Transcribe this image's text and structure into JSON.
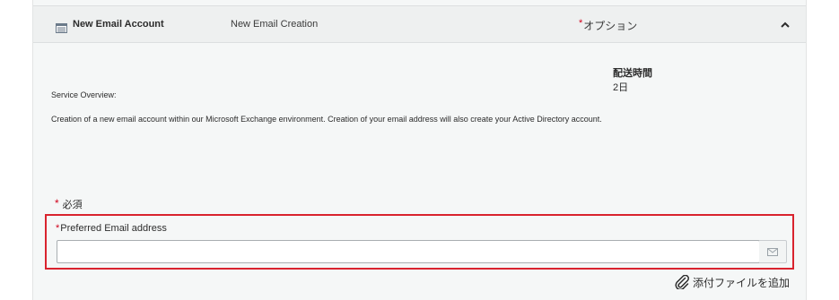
{
  "catalog_item": {
    "title": "New Email Account",
    "short_description": "New Email Creation",
    "option_marker": "*",
    "option_label": "オプション",
    "item_icon": "catalog-item-icon",
    "collapse_icon": "chevron-up-icon"
  },
  "delivery": {
    "label": "配送時間",
    "value": "2日"
  },
  "service_overview": {
    "heading": "Service Overview:",
    "body": "Creation of a new email account within our Microsoft Exchange environment. Creation of your email address will also create your Active Directory account."
  },
  "form": {
    "required_marker": "*",
    "required_note": "必須",
    "fields": [
      {
        "label": "Preferred Email address",
        "required": true,
        "value": "",
        "addon_icon": "envelope-icon"
      }
    ]
  },
  "attachment": {
    "label": "添付ファイルを追加",
    "icon": "paperclip-icon"
  },
  "colors": {
    "required": "#d0021b",
    "highlight_border": "#d9232e",
    "panel_bg": "#f5f7f7"
  }
}
